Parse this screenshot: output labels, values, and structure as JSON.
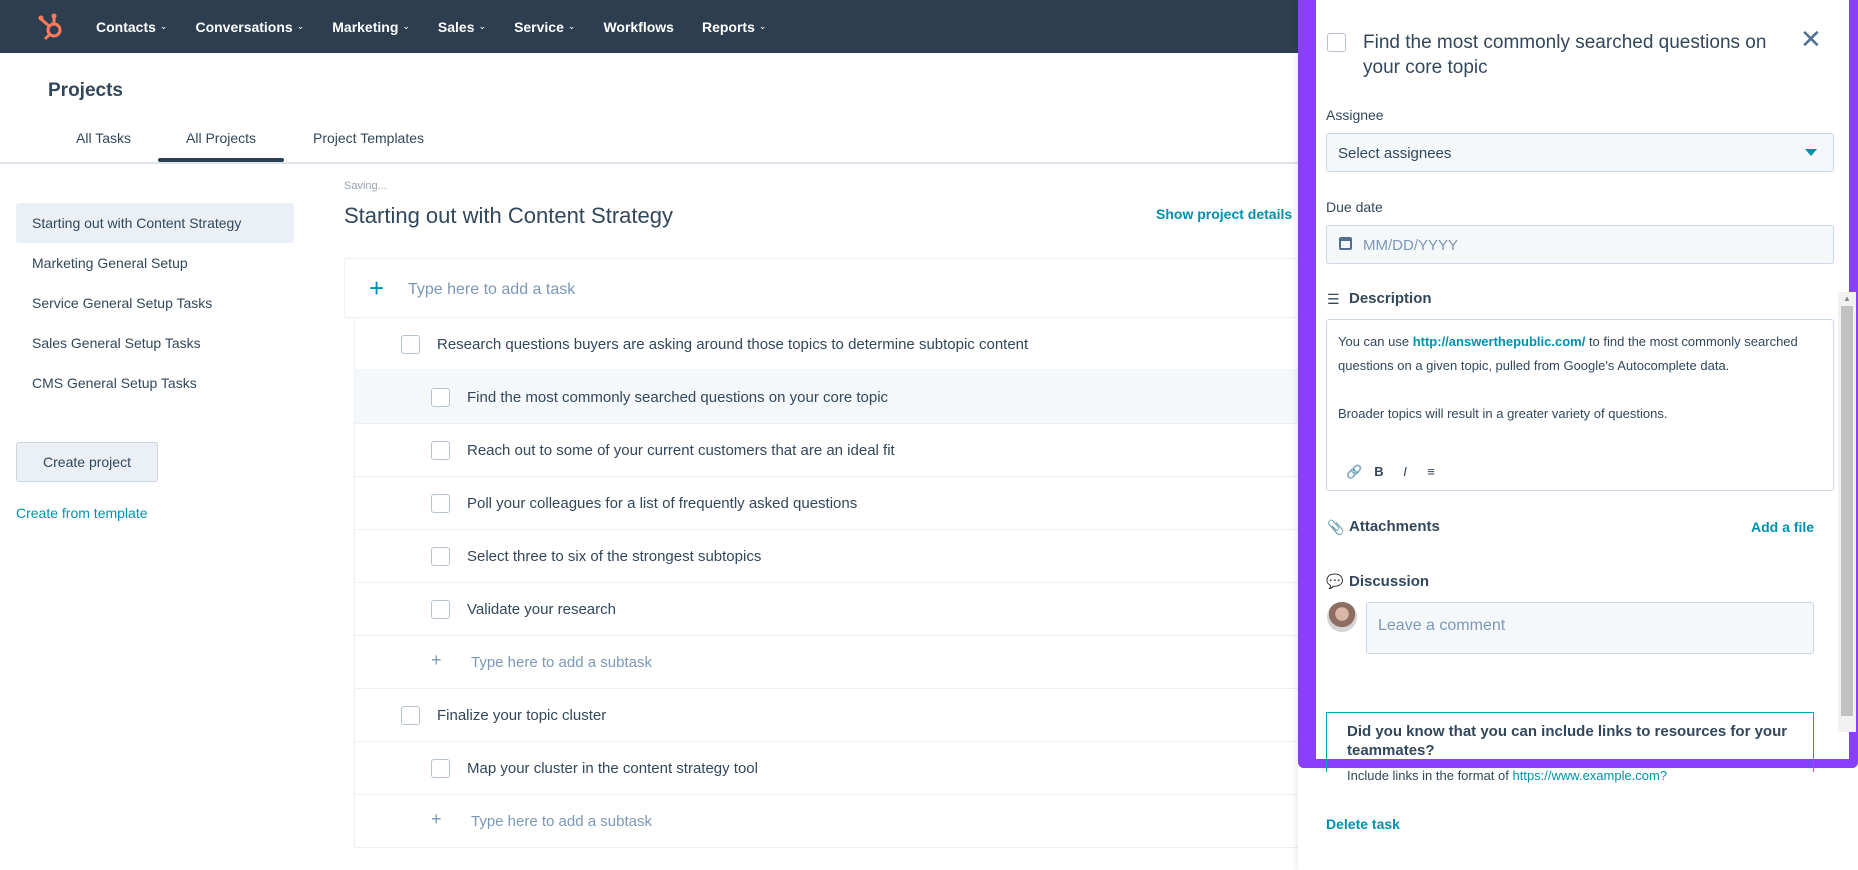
{
  "nav": {
    "logo": "hubspot-logo",
    "items": [
      "Contacts",
      "Conversations",
      "Marketing",
      "Sales",
      "Service",
      "Workflows",
      "Reports"
    ],
    "has_chevron": [
      true,
      true,
      true,
      true,
      true,
      false,
      true
    ]
  },
  "header": {
    "title": "Projects",
    "tabs": [
      "All Tasks",
      "All Projects",
      "Project Templates"
    ],
    "active_tab": "All Projects"
  },
  "sidebar": {
    "items": [
      "Starting out with Content Strategy",
      "Marketing General Setup",
      "Service General Setup Tasks",
      "Sales General Setup Tasks",
      "CMS General Setup Tasks"
    ],
    "active": "Starting out with Content Strategy",
    "create_button": "Create project",
    "template_link": "Create from template"
  },
  "main": {
    "saving": "Saving...",
    "title": "Starting out with Content Strategy",
    "show_details": "Show project details",
    "add_task_placeholder": "Type here to add a task",
    "tasks": [
      {
        "text": "Research questions buyers are asking around those topics to determine subtopic content",
        "level": 0
      },
      {
        "text": "Find the most commonly searched questions on your core topic",
        "level": 1,
        "highlighted": true
      },
      {
        "text": "Reach out to some of your current customers that are an ideal fit",
        "level": 1
      },
      {
        "text": "Poll your colleagues for a list of frequently asked questions",
        "level": 1
      },
      {
        "text": "Select three to six of the strongest subtopics",
        "level": 1
      },
      {
        "text": "Validate your research",
        "level": 1
      },
      {
        "text": "Type here to add a subtask",
        "level": "add"
      },
      {
        "text": "Finalize your topic cluster",
        "level": 0
      },
      {
        "text": "Map your cluster in the content strategy tool",
        "level": 1
      },
      {
        "text": "Type here to add a subtask",
        "level": "add"
      }
    ]
  },
  "panel": {
    "title": "Find the most commonly searched questions on your core topic",
    "assignee_label": "Assignee",
    "assignee_value": "Select assignees",
    "due_label": "Due date",
    "due_placeholder": "MM/DD/YYYY",
    "description_label": "Description",
    "description_pre": "You can use ",
    "description_link": "http://answerthepublic.com/",
    "description_post": " to find the most commonly searched questions on a given topic, pulled from Google's Autocomplete data.",
    "description_p2": "Broader topics will result in a greater variety of questions.",
    "toolbar": [
      "link-icon",
      "bold-icon",
      "italic-icon",
      "list-icon"
    ],
    "attachments_label": "Attachments",
    "add_file": "Add a file",
    "discussion_label": "Discussion",
    "comment_placeholder": "Leave a comment",
    "tip_heading": "Did you know that you can include links to resources for your teammates?",
    "tip_line_pre": "Include links in the format of ",
    "tip_line_link": "https://www.example.com?",
    "delete": "Delete task"
  },
  "colors": {
    "nav_bg": "#2d3e50",
    "accent": "#0091ae",
    "highlight_frame": "#8a3ffc",
    "logo": "#ff7a59"
  }
}
